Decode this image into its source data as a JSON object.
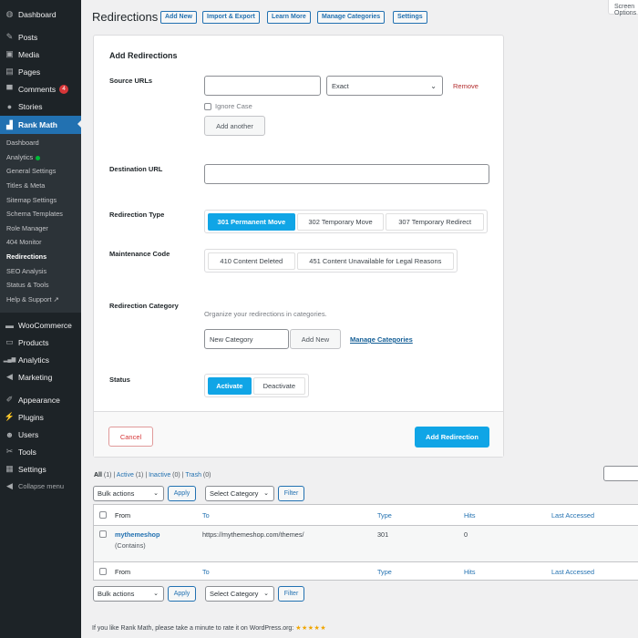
{
  "sidebar": {
    "menu": [
      {
        "label": "Dashboard",
        "icon": "dashboard-icon",
        "glyph": "◍"
      },
      {
        "label": "Posts",
        "icon": "pin-icon",
        "glyph": "✎"
      },
      {
        "label": "Media",
        "icon": "media-icon",
        "glyph": "▣"
      },
      {
        "label": "Pages",
        "icon": "pages-icon",
        "glyph": "▤"
      },
      {
        "label": "Comments",
        "icon": "comment-icon",
        "glyph": "▀",
        "badge": "4"
      },
      {
        "label": "Stories",
        "icon": "stories-icon",
        "glyph": "●"
      },
      {
        "label": "Rank Math",
        "icon": "rank-math-icon",
        "glyph": "▟"
      }
    ],
    "submenu": [
      {
        "label": "Dashboard"
      },
      {
        "label": "Analytics",
        "dot": true
      },
      {
        "label": "General Settings"
      },
      {
        "label": "Titles & Meta"
      },
      {
        "label": "Sitemap Settings"
      },
      {
        "label": "Schema Templates"
      },
      {
        "label": "Role Manager"
      },
      {
        "label": "404 Monitor"
      },
      {
        "label": "Redirections",
        "current": true
      },
      {
        "label": "SEO Analysis"
      },
      {
        "label": "Status & Tools"
      },
      {
        "label": "Help & Support ↗"
      }
    ],
    "menu2": [
      {
        "label": "WooCommerce",
        "icon": "woocommerce-icon",
        "glyph": "▬"
      },
      {
        "label": "Products",
        "icon": "products-icon",
        "glyph": "▭"
      },
      {
        "label": "Analytics",
        "icon": "bar-chart-icon",
        "glyph": "▂▄▆"
      },
      {
        "label": "Marketing",
        "icon": "megaphone-icon",
        "glyph": "◀"
      },
      {
        "label": "Appearance",
        "icon": "brush-icon",
        "glyph": "✐"
      },
      {
        "label": "Plugins",
        "icon": "plugin-icon",
        "glyph": "⚡"
      },
      {
        "label": "Users",
        "icon": "user-icon",
        "glyph": "☻"
      },
      {
        "label": "Tools",
        "icon": "wrench-icon",
        "glyph": "✂"
      },
      {
        "label": "Settings",
        "icon": "settings-icon",
        "glyph": "▦"
      },
      {
        "label": "Collapse menu",
        "icon": "collapse-icon",
        "glyph": "◀"
      }
    ]
  },
  "header": {
    "title": "Redirections",
    "buttons": [
      "Add New",
      "Import & Export",
      "Learn More",
      "Manage Categories",
      "Settings"
    ],
    "screen_options": "Screen Options"
  },
  "form": {
    "heading": "Add Redirections",
    "source_label": "Source URLs",
    "source_value": "",
    "match_type": "Exact",
    "remove": "Remove",
    "ignore_case": "Ignore Case",
    "add_another": "Add another",
    "destination_label": "Destination URL",
    "destination_value": "",
    "type_label": "Redirection Type",
    "types": [
      "301 Permanent Move",
      "302 Temporary Move",
      "307 Temporary Redirect"
    ],
    "type_selected": "301 Permanent Move",
    "maintenance_label": "Maintenance Code",
    "maintenance": [
      "410 Content Deleted",
      "451 Content Unavailable for Legal Reasons"
    ],
    "category_label": "Redirection Category",
    "category_hint": "Organize your redirections in categories.",
    "category_placeholder": "New Category",
    "category_add": "Add New",
    "manage_categories": "Manage Categories",
    "status_label": "Status",
    "status_options": [
      "Activate",
      "Deactivate"
    ],
    "status_selected": "Activate",
    "cancel": "Cancel",
    "submit": "Add Redirection"
  },
  "list": {
    "views": [
      {
        "label": "All",
        "count": "(1)"
      },
      {
        "label": "Active",
        "count": "(1)"
      },
      {
        "label": "Inactive",
        "count": "(0)"
      },
      {
        "label": "Trash",
        "count": "(0)"
      }
    ],
    "bulk_actions": "Bulk actions",
    "apply": "Apply",
    "select_category": "Select Category",
    "filter": "Filter",
    "columns": [
      "From",
      "To",
      "Type",
      "Hits",
      "Last Accessed"
    ],
    "rows": [
      {
        "from": "mythemeshop",
        "match": "(Contains)",
        "to": "https://mythemeshop.com/themes/",
        "type": "301",
        "hits": "0",
        "last_accessed": ""
      }
    ]
  },
  "footer": {
    "text": "If you like Rank Math, please take a minute to rate it on WordPress.org:",
    "stars": "★★★★★"
  }
}
